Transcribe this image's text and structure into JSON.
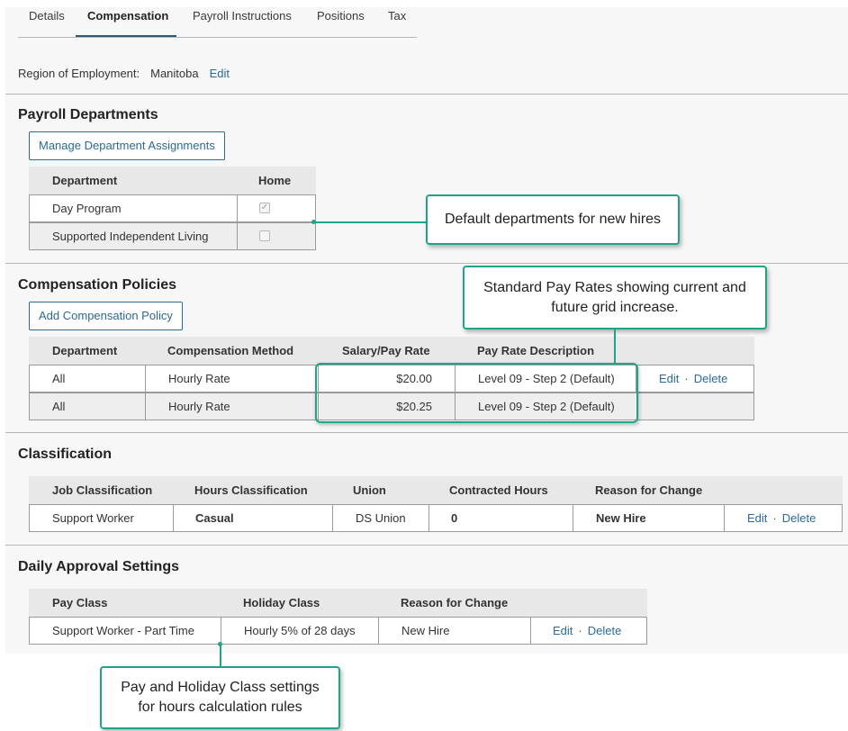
{
  "tabs": [
    {
      "label": "Details"
    },
    {
      "label": "Compensation"
    },
    {
      "label": "Payroll Instructions"
    },
    {
      "label": "Positions"
    },
    {
      "label": "Tax"
    }
  ],
  "active_tab": "Compensation",
  "region": {
    "label": "Region of Employment:",
    "value": "Manitoba",
    "edit": "Edit"
  },
  "payroll_departments": {
    "title": "Payroll Departments",
    "manage_button": "Manage Department Assignments",
    "headers": [
      "Department",
      "Home"
    ],
    "rows": [
      {
        "department": "Day Program",
        "home": true
      },
      {
        "department": "Supported Independent Living",
        "home": false
      }
    ]
  },
  "compensation_policies": {
    "title": "Compensation Policies",
    "add_button": "Add Compensation Policy",
    "headers": [
      "Department",
      "Compensation Method",
      "Salary/Pay Rate",
      "Pay Rate Description"
    ],
    "rows": [
      {
        "department": "All",
        "method": "Hourly Rate",
        "rate": "$20.00",
        "description": "Level 09 - Step 2 (Default)",
        "edit": "Edit",
        "delete": "Delete"
      },
      {
        "department": "All",
        "method": "Hourly Rate",
        "rate": "$20.25",
        "description": "Level 09 - Step 2 (Default)"
      }
    ]
  },
  "classification": {
    "title": "Classification",
    "headers": [
      "Job Classification",
      "Hours Classification",
      "Union",
      "Contracted Hours",
      "Reason for Change"
    ],
    "rows": [
      {
        "job": "Support Worker",
        "hours": "Casual",
        "union": "DS Union",
        "contracted": "0",
        "reason": "New Hire",
        "edit": "Edit",
        "delete": "Delete"
      }
    ]
  },
  "daily_approval": {
    "title": "Daily Approval Settings",
    "headers": [
      "Pay Class",
      "Holiday Class",
      "Reason for Change"
    ],
    "rows": [
      {
        "pay_class": "Support Worker - Part Time",
        "holiday_class": "Hourly 5% of 28 days",
        "reason": "New Hire",
        "edit": "Edit",
        "delete": "Delete"
      }
    ]
  },
  "callouts": {
    "departments": "Default departments for new hires",
    "pay_rates": "Standard Pay Rates showing current and future grid increase.",
    "pay_holiday": "Pay and Holiday Class settings for hours calculation rules"
  },
  "colors": {
    "accent": "#1fa389",
    "link": "#2a6b99",
    "header_bg": "#e8e8e8"
  }
}
